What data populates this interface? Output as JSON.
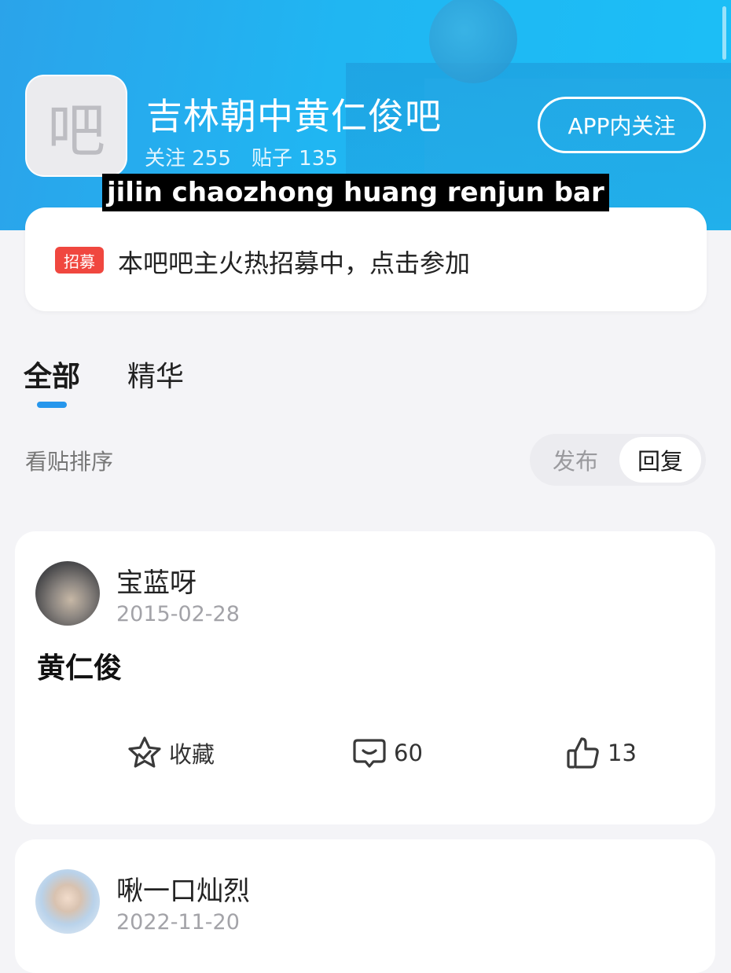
{
  "header": {
    "logo_char": "吧",
    "title": "吉林朝中黄仁俊吧",
    "stats": {
      "follow": "关注 255",
      "posts": "贴子 135"
    },
    "follow_button": "APP内关注"
  },
  "caption": "jilin chaozhong huang renjun bar",
  "recruit": {
    "badge": "招募",
    "text": "本吧吧主火热招募中，点击参加"
  },
  "tabs": [
    {
      "label": "全部"
    },
    {
      "label": "精华"
    }
  ],
  "sort": {
    "label": "看贴排序",
    "options": [
      "发布",
      "回复"
    ],
    "selected": "回复"
  },
  "posts": [
    {
      "user": "宝蓝呀",
      "date": "2015-02-28",
      "title": "黄仁俊",
      "actions": {
        "collect": "收藏",
        "comments": "60",
        "likes": "13"
      }
    },
    {
      "user": "啾一口灿烈",
      "date": "2022-11-20"
    }
  ],
  "colors": {
    "accent": "#2696ec",
    "header": "#1fb4f2",
    "badge": "#f0473f"
  },
  "icons": [
    "star-check-icon",
    "comment-bubble-icon",
    "thumbs-up-icon"
  ]
}
